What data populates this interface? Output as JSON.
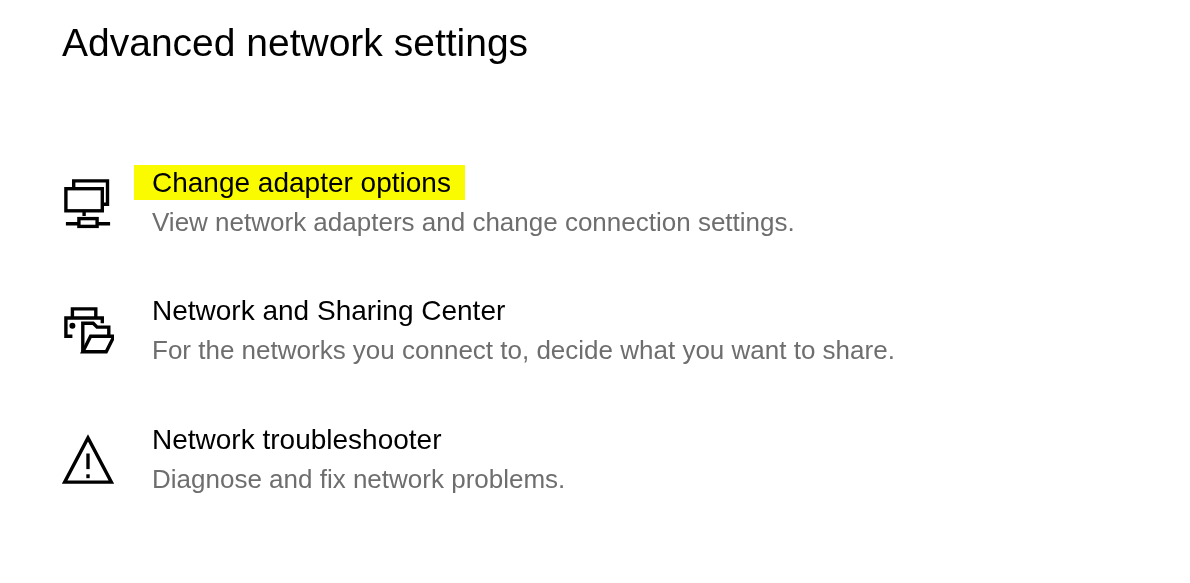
{
  "title": "Advanced network settings",
  "items": [
    {
      "kind": "adapter",
      "title": "Change adapter options",
      "description": "View network adapters and change connection settings.",
      "highlighted": true
    },
    {
      "kind": "sharing",
      "title": "Network and Sharing Center",
      "description": "For the networks you connect to, decide what you want to share.",
      "highlighted": false
    },
    {
      "kind": "troubleshooter",
      "title": "Network troubleshooter",
      "description": "Diagnose and fix network problems.",
      "highlighted": false
    }
  ]
}
